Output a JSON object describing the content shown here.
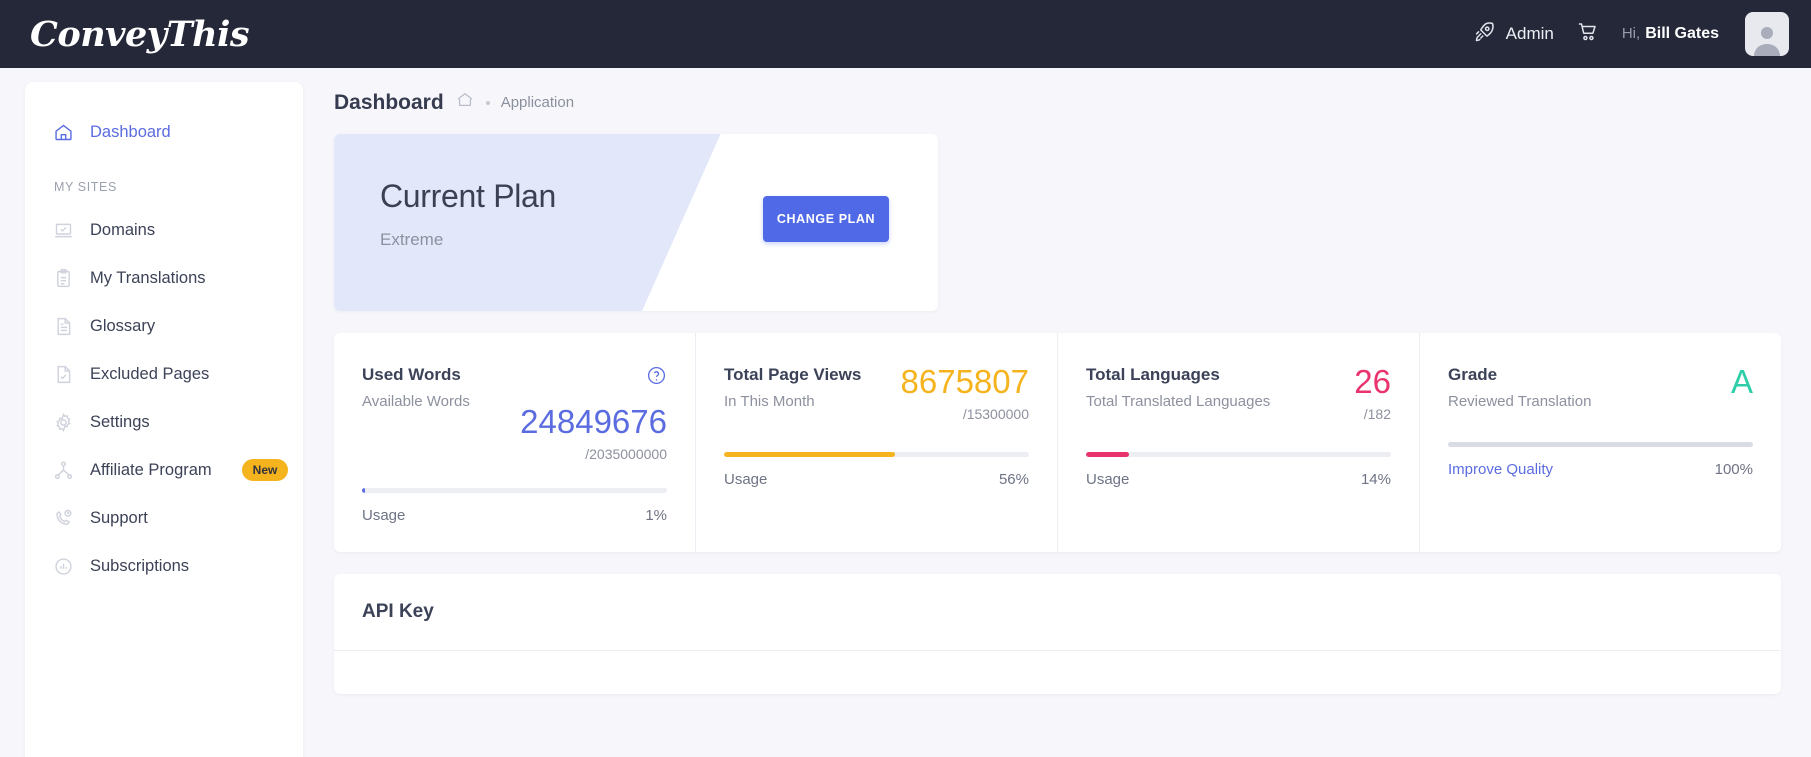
{
  "topbar": {
    "logo": "ConveyThis",
    "admin_label": "Admin",
    "greeting": "Hi,",
    "user_name": "Bill Gates",
    "rocket_icon": "rocket-icon",
    "cart_icon": "cart-icon",
    "avatar_icon": "avatar-icon"
  },
  "sidebar": {
    "primary": [
      {
        "label": "Dashboard",
        "icon": "home-icon",
        "active": true
      }
    ],
    "section_label": "MY SITES",
    "items": [
      {
        "label": "Domains",
        "icon": "laptop-check-icon"
      },
      {
        "label": "My Translations",
        "icon": "clipboard-icon"
      },
      {
        "label": "Glossary",
        "icon": "document-lines-icon"
      },
      {
        "label": "Excluded Pages",
        "icon": "document-check-icon"
      },
      {
        "label": "Settings",
        "icon": "gear-icon"
      },
      {
        "label": "Affiliate Program",
        "icon": "network-icon",
        "badge": "New"
      },
      {
        "label": "Support",
        "icon": "phone-question-icon"
      },
      {
        "label": "Subscriptions",
        "icon": "chart-circle-icon"
      }
    ]
  },
  "breadcrumb": {
    "title": "Dashboard",
    "home_icon": "home-outline-icon",
    "crumb": "Application"
  },
  "plan_card": {
    "title": "Current Plan",
    "plan_name": "Extreme",
    "button_label": "CHANGE PLAN"
  },
  "stats": [
    {
      "title": "Used Words",
      "subtitle": "Available Words",
      "value": "24849676",
      "total": "/2035000000",
      "value_color": "#5b6ce0",
      "bar_color": "#5b6ce0",
      "bar_percent": 1,
      "usage_label": "Usage",
      "usage_value": "1%",
      "help_icon": "help-circle-icon"
    },
    {
      "title": "Total Page Views",
      "subtitle": "In This Month",
      "value": "8675807",
      "total": "/15300000",
      "value_color": "#f5b31e",
      "bar_color": "#f5b31e",
      "bar_percent": 56,
      "usage_label": "Usage",
      "usage_value": "56%"
    },
    {
      "title": "Total Languages",
      "subtitle": "Total Translated Languages",
      "value": "26",
      "total": "/182",
      "value_color": "#e8336d",
      "bar_color": "#e8336d",
      "bar_percent": 14,
      "usage_label": "Usage",
      "usage_value": "14%"
    },
    {
      "title": "Grade",
      "subtitle": "Reviewed Translation",
      "value": "A",
      "total": "",
      "value_color": "#2ecfa8",
      "bar_color": "#d9dce4",
      "bar_percent": 100,
      "usage_label": "Improve Quality",
      "usage_value": "100%",
      "usage_is_link": true
    }
  ],
  "api_panel": {
    "title": "API Key"
  }
}
